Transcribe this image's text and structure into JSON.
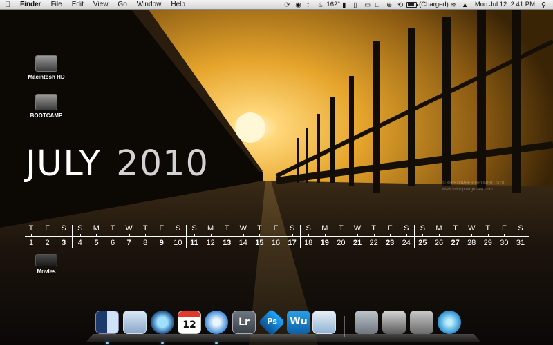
{
  "menubar": {
    "app_name": "Finder",
    "menus": [
      "File",
      "Edit",
      "View",
      "Go",
      "Window",
      "Help"
    ],
    "temperature": "162°",
    "battery_status": "(Charged)",
    "clock": "Mon Jul 12  2:41 PM"
  },
  "desktop_icons": [
    {
      "label": "Macintosh HD",
      "icon": "hard-drive-icon"
    },
    {
      "label": "BOOTCAMP",
      "icon": "hard-drive-icon"
    },
    {
      "label": "Movies",
      "icon": "folder-icon"
    }
  ],
  "calendar": {
    "month": "JULY",
    "year": "2010",
    "weekdays": [
      "T",
      "F",
      "S",
      "S",
      "M",
      "T",
      "W",
      "T",
      "F",
      "S",
      "S",
      "M",
      "T",
      "W",
      "T",
      "F",
      "S",
      "S",
      "M",
      "T",
      "W",
      "T",
      "F",
      "S",
      "S",
      "M",
      "T",
      "W",
      "T",
      "F",
      "S"
    ],
    "days": [
      "1",
      "2",
      "3",
      "4",
      "5",
      "6",
      "7",
      "8",
      "9",
      "10",
      "11",
      "12",
      "13",
      "14",
      "15",
      "16",
      "17",
      "18",
      "19",
      "20",
      "21",
      "22",
      "23",
      "24",
      "25",
      "26",
      "27",
      "28",
      "29",
      "30",
      "31"
    ],
    "bold_days": [
      "3",
      "5",
      "7",
      "9",
      "11",
      "13",
      "15",
      "17",
      "19",
      "21",
      "23",
      "25",
      "27"
    ]
  },
  "wallpaper_credit": {
    "line1": "© KRISTOPHER GRUNERT 2010",
    "line2": "www.kristophergrunert.com"
  },
  "dock": {
    "apps": [
      {
        "name": "finder",
        "icon": "finder-icon",
        "label": ""
      },
      {
        "name": "mail",
        "icon": "mail-icon",
        "label": ""
      },
      {
        "name": "time-machine",
        "icon": "time-machine-icon",
        "label": ""
      },
      {
        "name": "ical",
        "icon": "calendar-icon",
        "label": "12"
      },
      {
        "name": "itunes",
        "icon": "itunes-icon",
        "label": ""
      },
      {
        "name": "lightroom",
        "icon": "lightroom-icon",
        "label": "Lr"
      },
      {
        "name": "photoshop",
        "icon": "photoshop-icon",
        "label": "Ps"
      },
      {
        "name": "wordpress-app",
        "icon": "wu-icon",
        "label": "Wu"
      },
      {
        "name": "preview",
        "icon": "preview-icon",
        "label": ""
      },
      {
        "name": "applications-stack",
        "icon": "applications-stack-icon",
        "label": ""
      },
      {
        "name": "documents-stack",
        "icon": "documents-stack-icon",
        "label": ""
      },
      {
        "name": "downloads-stack",
        "icon": "downloads-stack-icon",
        "label": ""
      },
      {
        "name": "trash",
        "icon": "trash-icon",
        "label": ""
      }
    ]
  },
  "colors": {
    "sky": "#e6a52c",
    "sun": "#fff6c8",
    "dock_glow": "#7fd6ff"
  }
}
